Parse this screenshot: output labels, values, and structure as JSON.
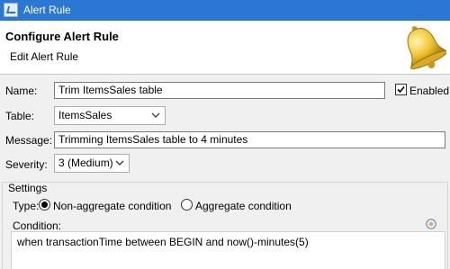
{
  "window": {
    "title": "Alert Rule"
  },
  "header": {
    "title": "Configure Alert Rule",
    "subtitle": "Edit Alert Rule"
  },
  "form": {
    "name_label": "Name:",
    "name_value": "Trim ItemsSales table",
    "enabled_label": "Enabled",
    "enabled_checked": true,
    "table_label": "Table:",
    "table_value": "ItemsSales",
    "message_label": "Message:",
    "message_value": "Trimming ItemsSales table to 4 minutes",
    "severity_label": "Severity:",
    "severity_value": "3 (Medium)"
  },
  "settings": {
    "group_label": "Settings",
    "type_label": "Type:",
    "option_nonaggregate": "Non-aggregate condition",
    "option_aggregate": "Aggregate condition",
    "selected": "Non-aggregate condition",
    "condition_label": "Condition:",
    "condition_value": "when transactionTime between BEGIN and now()-minutes(5)"
  },
  "icons": {
    "app": "window-app-icon",
    "bell": "bell-icon",
    "condition_help": "condition-help-icon"
  }
}
